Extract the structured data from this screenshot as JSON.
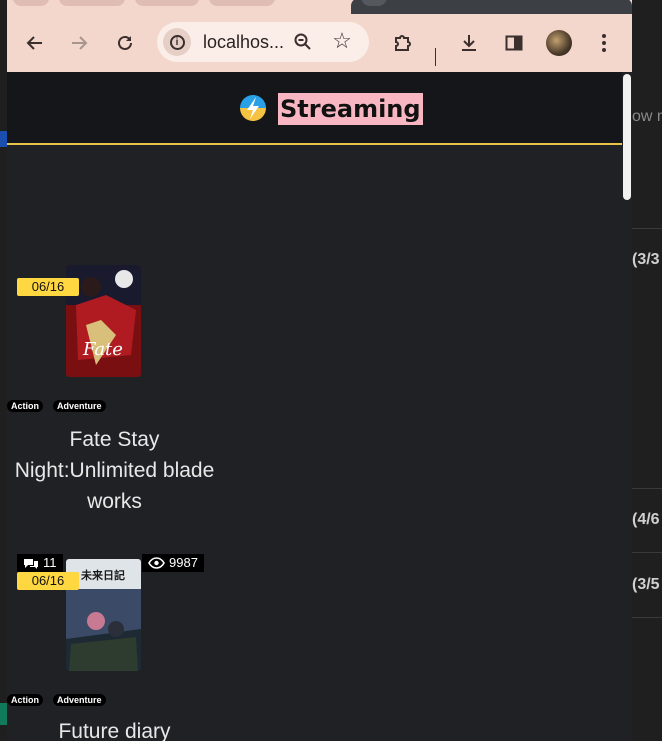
{
  "background_window": {
    "show_text": "ow m",
    "rows": [
      "(3/3",
      "(4/6",
      "(3/5"
    ]
  },
  "browser": {
    "toolbar": {
      "back_icon": "back-arrow-icon",
      "forward_icon": "forward-arrow-icon",
      "reload_icon": "reload-icon",
      "url": "localhos...",
      "zoom_icon": "zoom-icon",
      "bookmark_icon": "star-icon",
      "extensions_icon": "puzzle-icon",
      "download_icon": "download-icon",
      "sidepanel_icon": "side-panel-icon",
      "menu_icon": "kebab-menu-icon"
    }
  },
  "site": {
    "title": "Streaming",
    "logo_icon": "lightning-logo-icon",
    "accent_color": "#e8c34a"
  },
  "cards": [
    {
      "date": "06/16",
      "title": "Fate Stay Night:Unlimited blade works",
      "genres": [
        "Action",
        "Adventure"
      ],
      "poster_text": "Fate"
    },
    {
      "date": "06/16",
      "title": "Future diary",
      "genres": [
        "Action",
        "Adventure"
      ],
      "comments": "11",
      "views": "9987",
      "poster_text": "未来日記"
    }
  ]
}
